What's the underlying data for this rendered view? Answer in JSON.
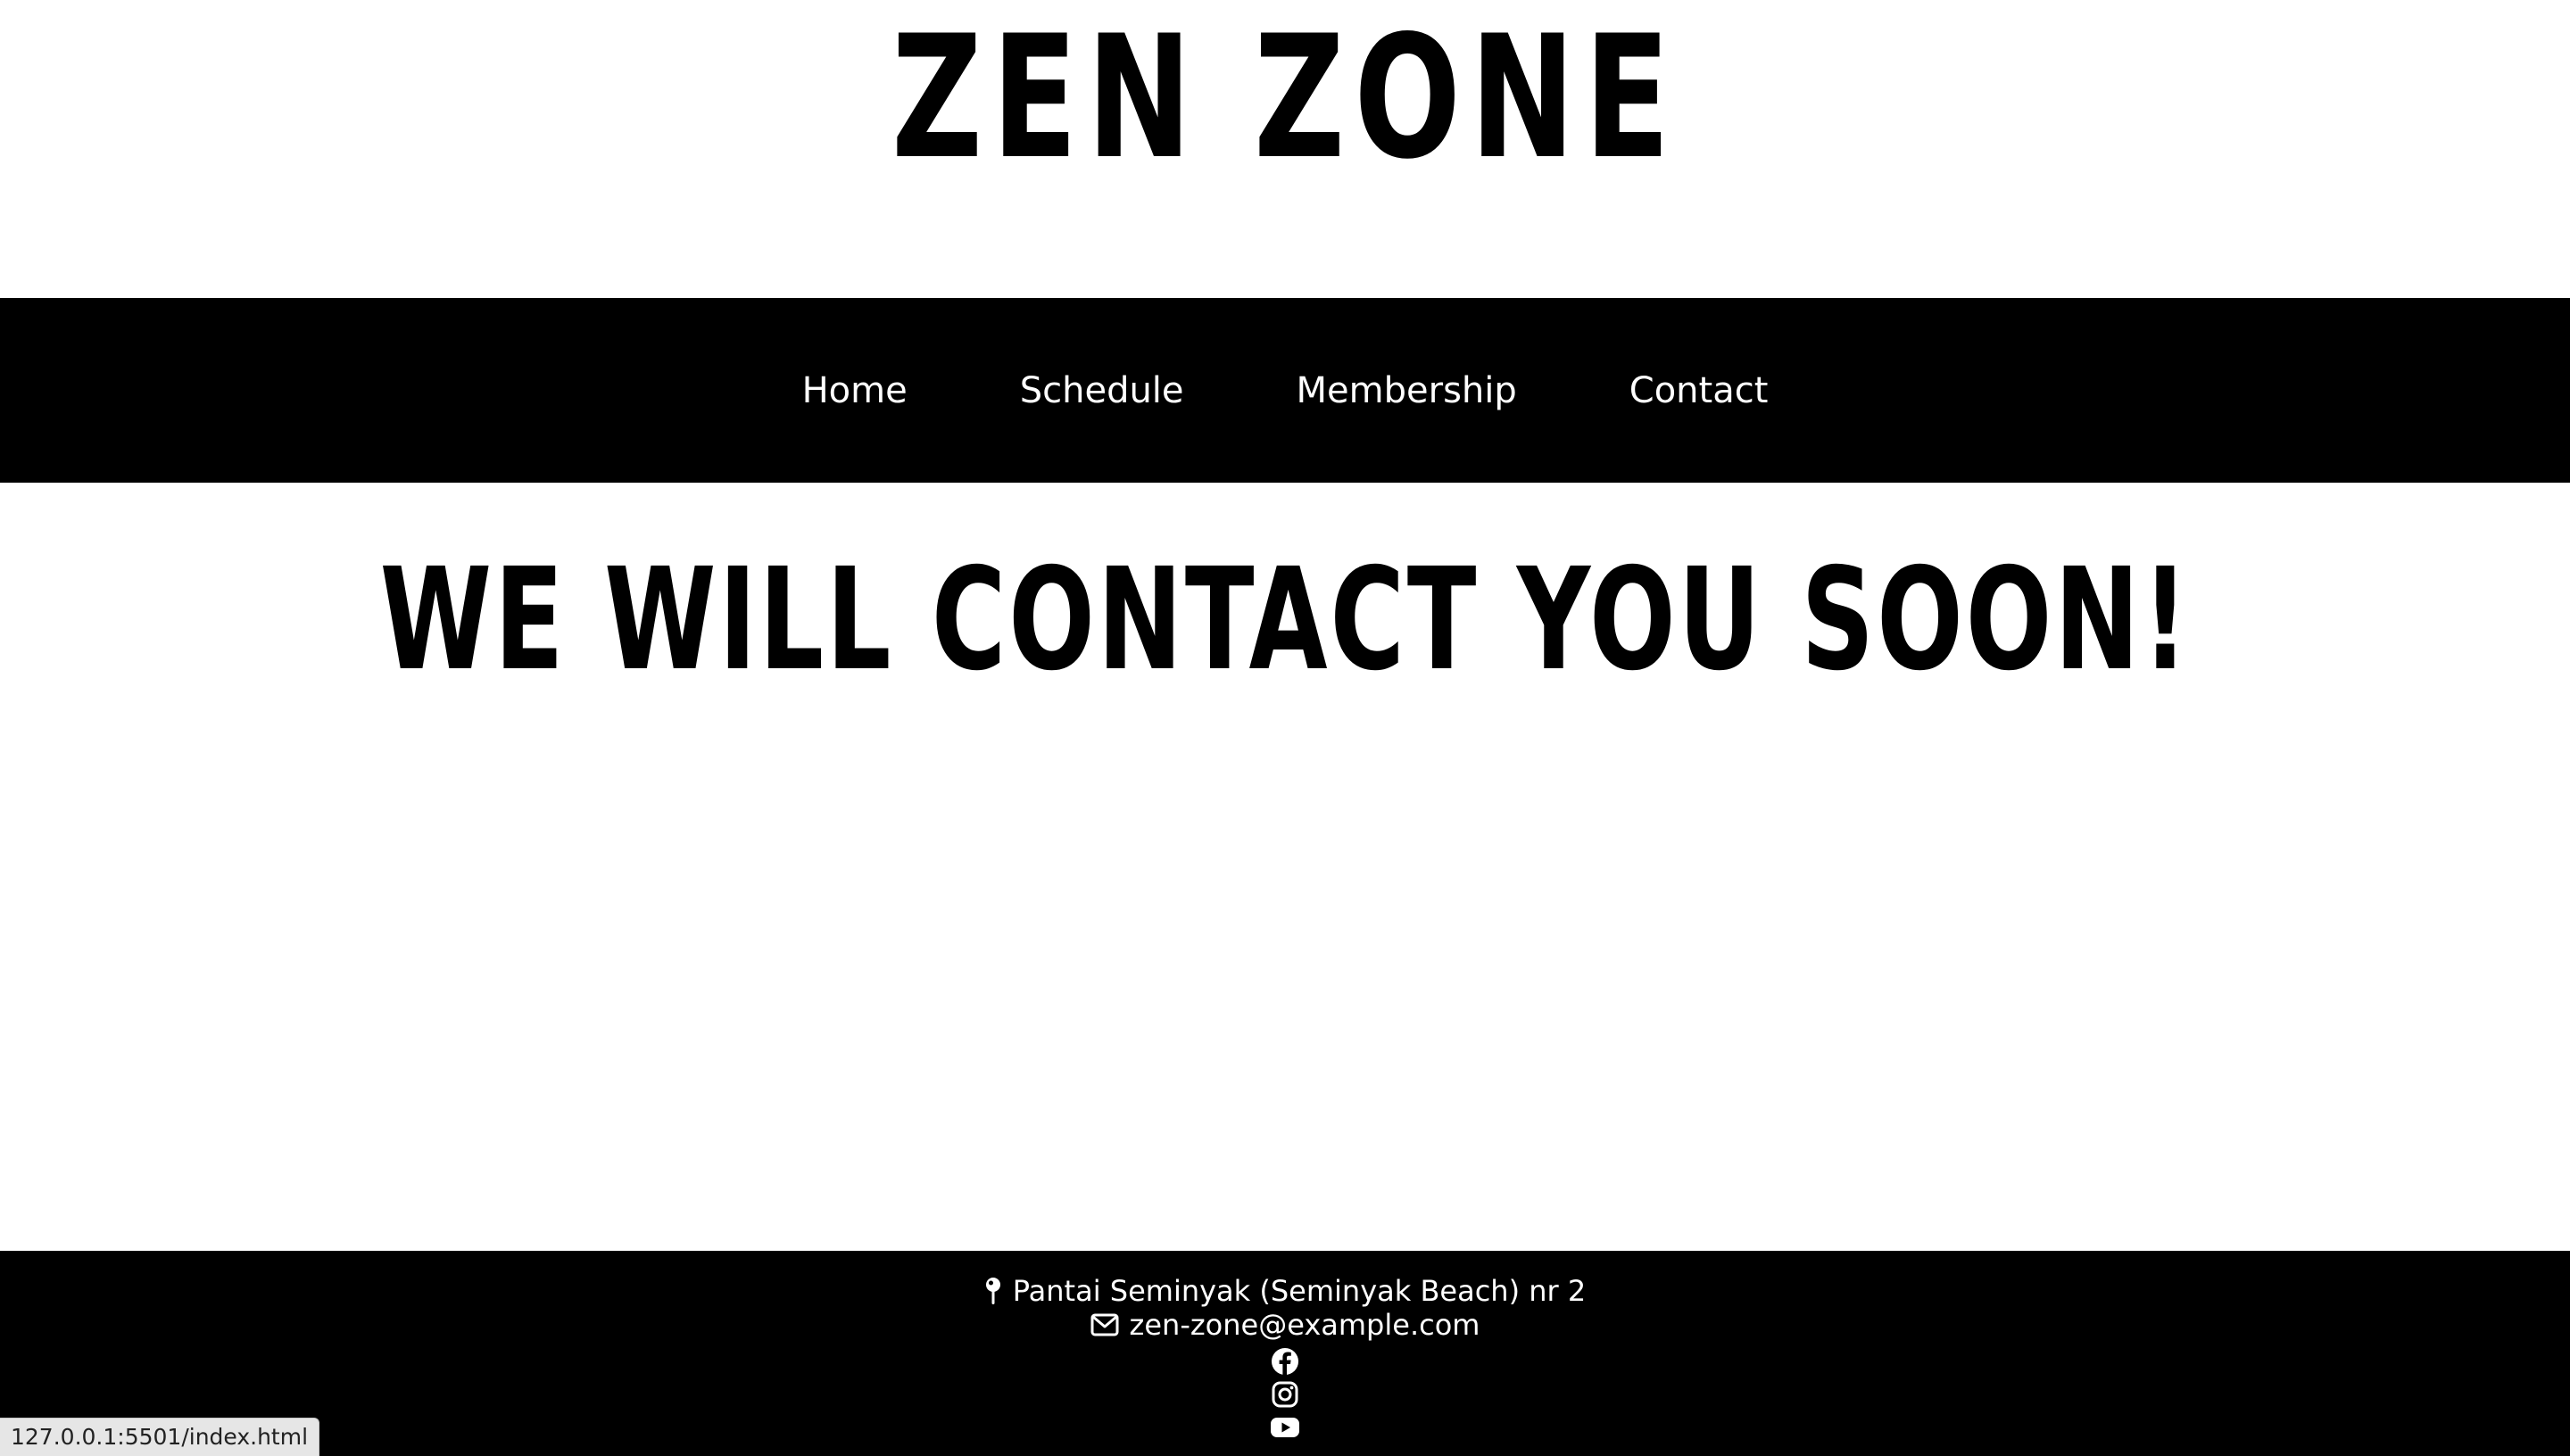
{
  "header": {
    "title": "ZEN ZONE"
  },
  "nav": {
    "items": [
      {
        "label": "Home"
      },
      {
        "label": "Schedule"
      },
      {
        "label": "Membership"
      },
      {
        "label": "Contact"
      }
    ]
  },
  "main": {
    "headline": "WE WILL CONTACT YOU SOON!"
  },
  "footer": {
    "address": "Pantai Seminyak (Seminyak Beach) nr 2",
    "address_icon": "map-pin-icon",
    "email": "zen-zone@example.com",
    "email_icon": "envelope-icon",
    "social_icons": [
      "facebook-icon",
      "instagram-icon",
      "youtube-icon"
    ]
  },
  "status_bar": {
    "url": "127.0.0.1:5501/index.html"
  },
  "colors": {
    "background": "#ffffff",
    "bars": "#000000",
    "text_light": "#ffffff",
    "text_dark": "#000000"
  }
}
